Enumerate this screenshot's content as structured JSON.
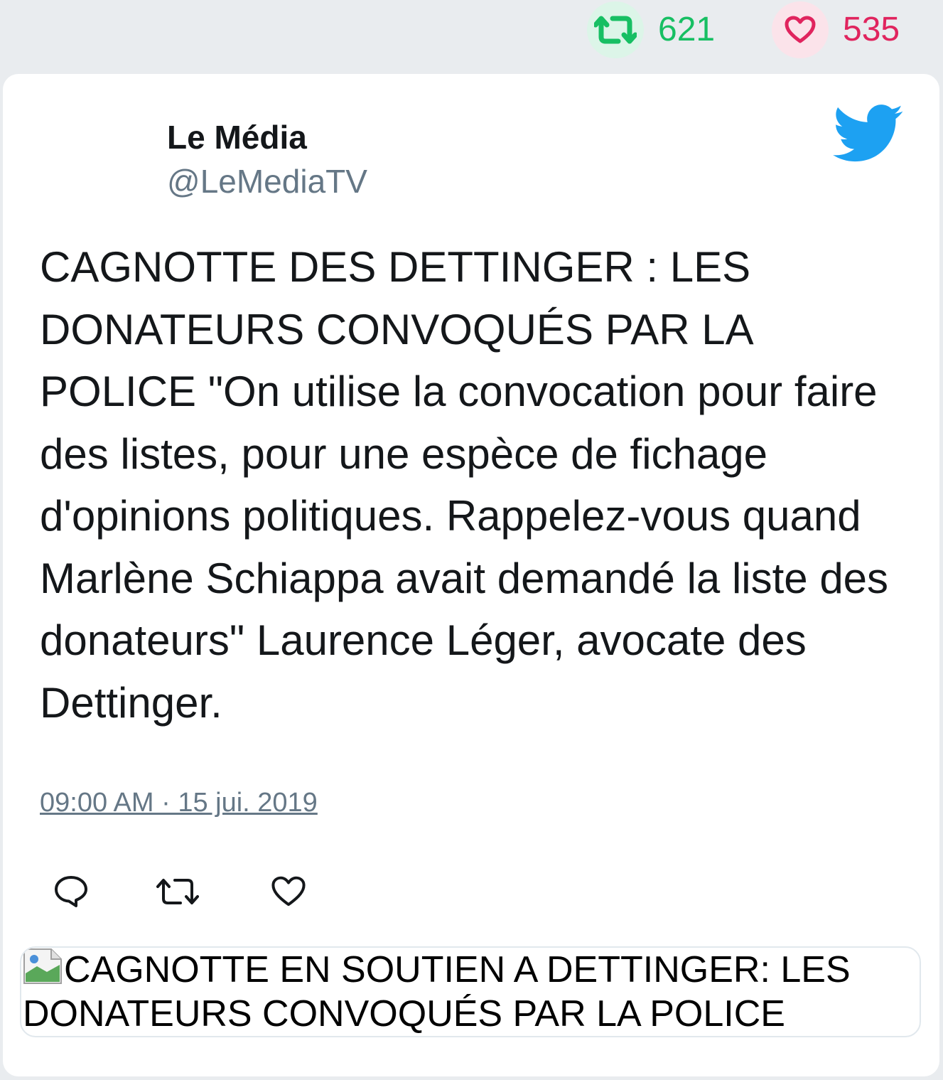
{
  "stats": {
    "retweets": "621",
    "likes": "535"
  },
  "tweet": {
    "author_name": "Le Média",
    "author_handle": "@LeMediaTV",
    "text": "CAGNOTTE DES DETTINGER : LES DONATEURS CONVOQUÉS PAR LA POLICE \"On utilise la convocation pour faire des listes, pour une espèce de fichage d'opinions politiques. Rappelez-vous quand Marlène Schiappa avait demandé la liste des donateurs\" Laurence Léger, avocate des Dettinger.",
    "timestamp": "09:00 AM · 15 jui. 2019"
  },
  "link_card": {
    "image_alt": "CAGNOTTE EN SOUTIEN A DETTINGER: LES DONATEURS CONVOQUÉS PAR LA POLICE"
  },
  "icons": {
    "retweet": "retweet-icon",
    "like": "heart-icon",
    "reply": "reply-icon",
    "brand": "twitter-bird-icon",
    "broken_image": "broken-image-icon"
  },
  "colors": {
    "retweet_green": "#17bf63",
    "like_red": "#e0245e",
    "twitter_blue": "#1da1f2",
    "muted_gray": "#657786"
  }
}
